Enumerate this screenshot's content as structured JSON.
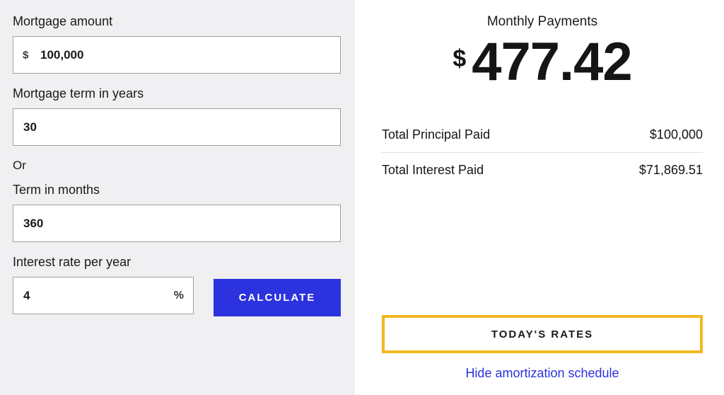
{
  "form": {
    "amount_label": "Mortgage amount",
    "amount_value": "100,000",
    "currency_symbol": "$",
    "term_years_label": "Mortgage term in years",
    "term_years_value": "30",
    "or_label": "Or",
    "term_months_label": "Term in months",
    "term_months_value": "360",
    "rate_label": "Interest rate per year",
    "rate_value": "4",
    "percent_symbol": "%",
    "calculate_label": "CALCULATE"
  },
  "results": {
    "monthly_label": "Monthly Payments",
    "currency_symbol": "$",
    "monthly_value": "477.42",
    "principal_label": "Total Principal Paid",
    "principal_value": "$100,000",
    "interest_label": "Total Interest Paid",
    "interest_value": "$71,869.51",
    "rates_button": "TODAY'S RATES",
    "hide_link": "Hide amortization schedule"
  }
}
